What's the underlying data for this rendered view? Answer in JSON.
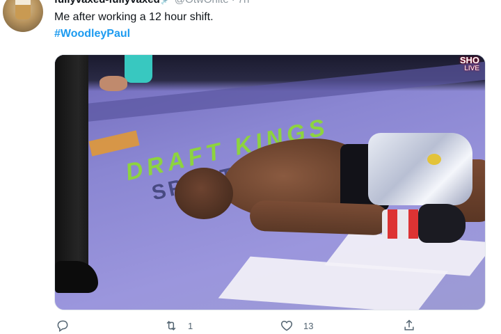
{
  "tweet": {
    "display_name": "fullyvaxed-fullyvaxed",
    "verified_glyph": "💉",
    "handle": "@OtwOhite",
    "separator": "·",
    "time": "7h",
    "text": "Me after working a 12 hour shift.",
    "hashtag": "#WoodleyPaul"
  },
  "media": {
    "network_logo": "SHO",
    "live_label": "LIVE",
    "mat_logo": "DRAFT KINGS",
    "mat_logo_sub": "SPORTSBOOK"
  },
  "actions": {
    "reply": {
      "icon": "reply-icon",
      "count": ""
    },
    "retweet": {
      "icon": "retweet-icon",
      "count": "1"
    },
    "like": {
      "icon": "heart-icon",
      "count": "13"
    },
    "share": {
      "icon": "share-icon",
      "count": ""
    }
  },
  "colors": {
    "hashtag": "#1d9bf0",
    "muted_text": "#536471",
    "text": "#0f1419"
  }
}
